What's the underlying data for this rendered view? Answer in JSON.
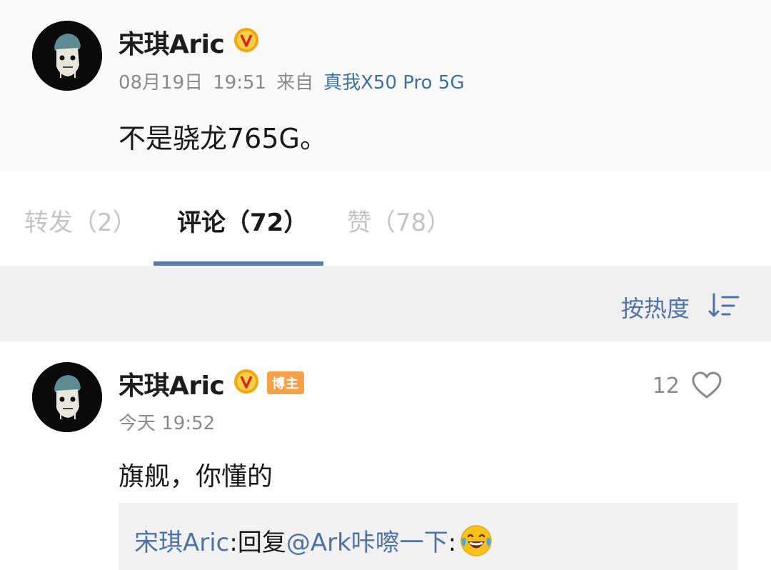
{
  "post": {
    "author_name": "宋琪Aric",
    "verified_icon": "verified-v-badge-icon",
    "date": "08月19日",
    "time": "19:51",
    "source_prefix": "来自",
    "device": "真我X50 Pro 5G",
    "text": "不是骁龙765G。"
  },
  "tabs": [
    {
      "label": "转发（2）",
      "active": false
    },
    {
      "label": "评论（72）",
      "active": true
    },
    {
      "label": "赞（78）",
      "active": false
    }
  ],
  "sort": {
    "label": "按热度",
    "icon": "sort-icon"
  },
  "comment": {
    "author_name": "宋琪Aric",
    "badge": "博主",
    "timestamp": "今天 19:52",
    "like_count": "12",
    "text": "旗舰，你懂的",
    "reply": {
      "author": "宋琪Aric",
      "separator": ":",
      "action": "回复",
      "target": "@Ark咔嚓一下",
      "separator2": ":",
      "emoji": "laughing-crying-emoji"
    }
  },
  "colors": {
    "link": "#4e72a8",
    "verified": "#f4a60c",
    "host_badge": "#f4a14a",
    "tab_indicator": "#5a7bb0"
  }
}
